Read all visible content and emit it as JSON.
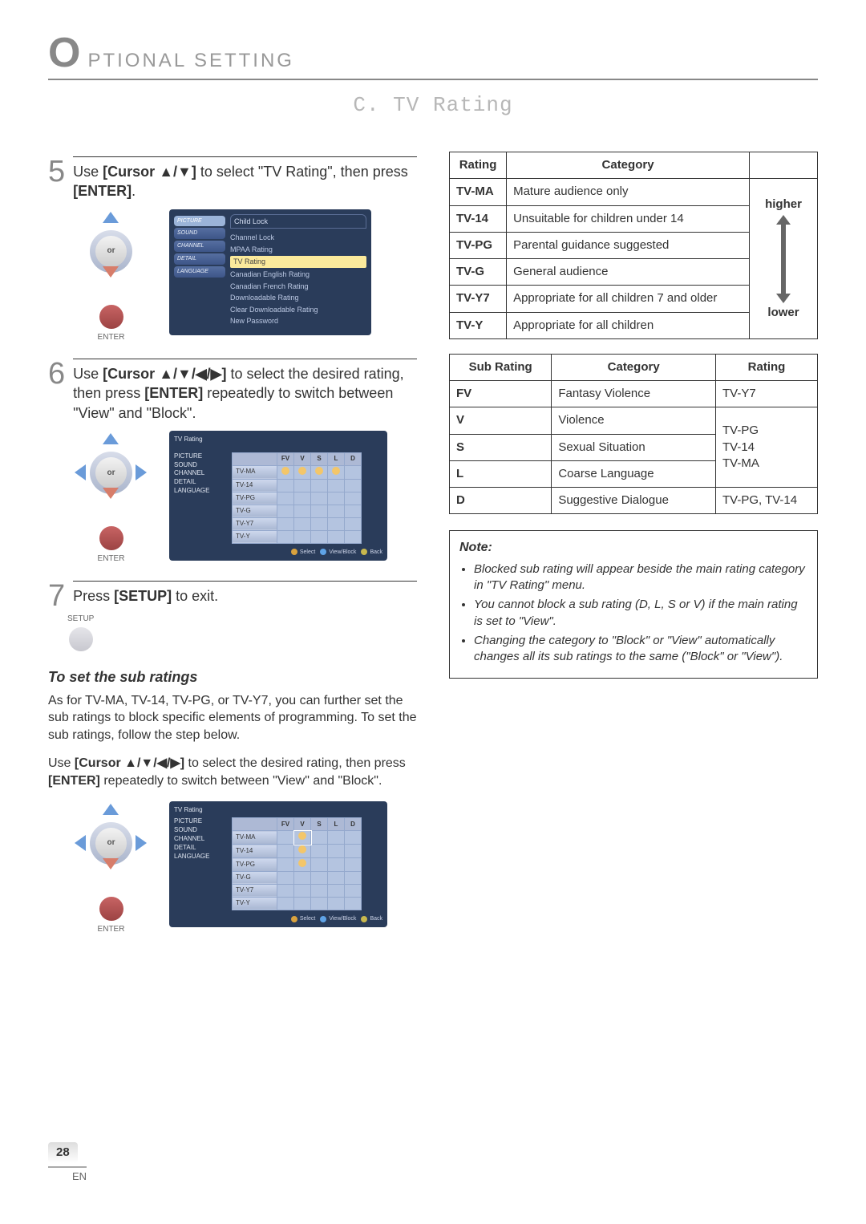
{
  "page": {
    "number": "28",
    "lang": "EN"
  },
  "header": {
    "big_letter": "O",
    "rest": "PTIONAL   SETTING",
    "section": "C. TV Rating"
  },
  "steps": {
    "s5": {
      "num": "5",
      "pre": "Use ",
      "cmd1": "[Cursor",
      "arrows": "▲/▼",
      "cmd2": "]",
      "mid": " to select \"TV Rating\", then press ",
      "enter": "[ENTER]",
      "suffix": ".",
      "remote": {
        "or": "or",
        "enter_label": "ENTER"
      },
      "mini": {
        "title": "Child Lock",
        "side": [
          "PICTURE",
          "SOUND",
          "CHANNEL",
          "DETAIL",
          "LANGUAGE"
        ],
        "items": [
          "Channel Lock",
          "MPAA Rating",
          "TV Rating",
          "Canadian English Rating",
          "Canadian French Rating",
          "Downloadable Rating",
          "Clear Downloadable Rating",
          "New Password"
        ],
        "sel": "TV Rating"
      }
    },
    "s6": {
      "num": "6",
      "pre": "Use ",
      "cmd1": "[Cursor",
      "arrows": "▲/▼/◀/▶",
      "cmd2": "]",
      "mid": " to select the desired rating, then press ",
      "enter": "[ENTER]",
      "post": " repeatedly to switch between \"View\" and \"Block\".",
      "remote": {
        "or": "or",
        "enter_label": "ENTER"
      },
      "grid": {
        "title": "TV Rating",
        "side": [
          "PICTURE",
          "SOUND",
          "CHANNEL",
          "DETAIL",
          "LANGUAGE"
        ],
        "cols": [
          "FV",
          "V",
          "S",
          "L",
          "D"
        ],
        "rows": [
          "TV-MA",
          "TV-14",
          "TV-PG",
          "TV-G",
          "TV-Y7",
          "TV-Y"
        ],
        "blocked": {
          "TV-MA": [
            "rating",
            "V",
            "S",
            "L"
          ]
        },
        "footer": {
          "select": "Select",
          "view": "View/Block",
          "back": "Back"
        }
      }
    },
    "s7": {
      "num": "7",
      "text": "Press ",
      "setup": "[SETUP]",
      "after": " to exit.",
      "label": "SETUP"
    }
  },
  "sub": {
    "heading": "To set the sub ratings",
    "para": "As for TV-MA, TV-14, TV-PG, or TV-Y7, you can further set the sub ratings to block specific elements of programming. To set the sub ratings, follow the step below.",
    "instr_pre": "Use ",
    "cmd1": "[Cursor",
    "arrows": "▲/▼/◀/▶",
    "cmd2": "]",
    "mid": " to select the desired rating, then press ",
    "enter": "[ENTER]",
    "post": " repeatedly to switch between \"View\" and \"Block\".",
    "remote": {
      "or": "or",
      "enter_label": "ENTER"
    },
    "grid": {
      "title": "TV Rating",
      "side": [
        "PICTURE",
        "SOUND",
        "CHANNEL",
        "DETAIL",
        "LANGUAGE"
      ],
      "cols": [
        "FV",
        "V",
        "S",
        "L",
        "D"
      ],
      "rows": [
        "TV-MA",
        "TV-14",
        "TV-PG",
        "TV-G",
        "TV-Y7",
        "TV-Y"
      ],
      "blocked": {
        "TV-MA": [
          "V"
        ],
        "TV-14": [
          "V"
        ],
        "TV-PG": [
          "V"
        ]
      },
      "sel": "V",
      "footer": {
        "select": "Select",
        "view": "View/Block",
        "back": "Back"
      }
    }
  },
  "right": {
    "ratings": {
      "headers": [
        "Rating",
        "Category",
        ""
      ],
      "rows": [
        {
          "r": "TV-MA",
          "c": "Mature audience only"
        },
        {
          "r": "TV-14",
          "c": "Unsuitable for children under 14"
        },
        {
          "r": "TV-PG",
          "c": "Parental guidance suggested"
        },
        {
          "r": "TV-G",
          "c": "General audience"
        },
        {
          "r": "TV-Y7",
          "c": "Appropriate for all children 7 and older"
        },
        {
          "r": "TV-Y",
          "c": "Appropriate for all children"
        }
      ],
      "scale": {
        "top": "higher",
        "bottom": "lower"
      }
    },
    "subs": {
      "headers": [
        "Sub Rating",
        "Category",
        "Rating"
      ],
      "rows": [
        {
          "s": "FV",
          "c": "Fantasy Violence",
          "r": "TV-Y7"
        },
        {
          "s": "V",
          "c": "Violence",
          "r": ""
        },
        {
          "s": "S",
          "c": "Sexual Situation",
          "r": ""
        },
        {
          "s": "L",
          "c": "Coarse Language",
          "r": ""
        },
        {
          "s": "D",
          "c": "Suggestive Dialogue",
          "r": "TV-PG, TV-14"
        }
      ],
      "merged_rating": "TV-PG\nTV-14\nTV-MA"
    },
    "note": {
      "title": "Note:",
      "items": [
        "Blocked sub rating will appear beside the main rating category in \"TV Rating\" menu.",
        "You cannot block a sub rating (D, L, S or V) if the main rating is set to \"View\".",
        "Changing the category to \"Block\" or \"View\" automatically changes all its sub ratings to the same (\"Block\" or \"View\")."
      ]
    }
  },
  "icons": {
    "select": "#d9a23e",
    "view": "#5fa3e6",
    "back": "#c8b84e"
  }
}
